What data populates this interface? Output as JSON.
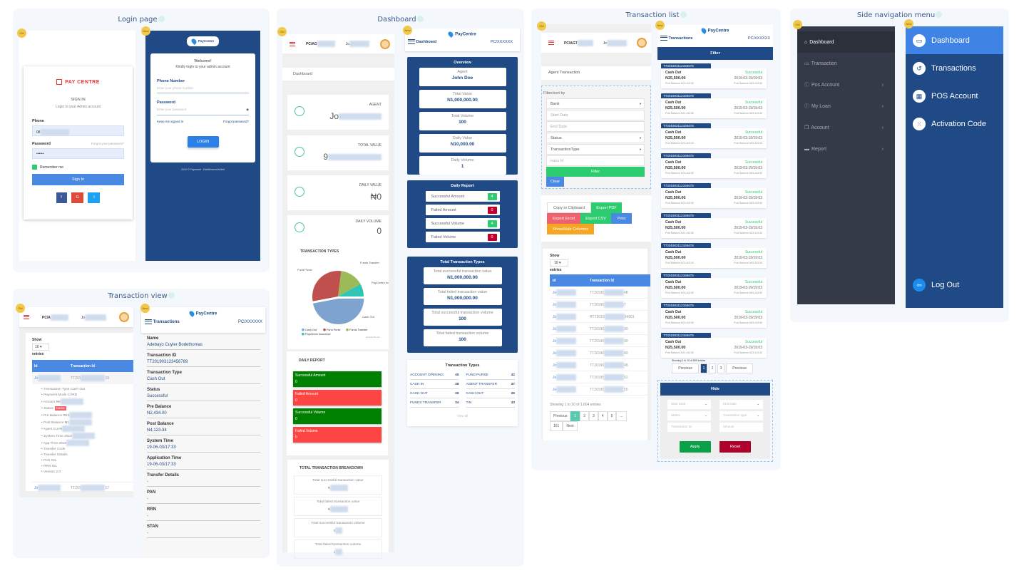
{
  "badges": {
    "old": "Old",
    "new": "New"
  },
  "brand": {
    "name": "PayCentre",
    "old_logo": "PAY CENTRE",
    "footer": "2019 © Paycentre - Esettlement limited"
  },
  "colors": {
    "navy": "#1f4a85",
    "blue": "#4a89e3",
    "green": "#008000",
    "red": "#ff4444",
    "success": "#2ecc71",
    "danger": "#c0392b"
  },
  "login": {
    "title": "Login page",
    "old": {
      "heading": "SIGN IN",
      "subheading": "Login to your Admin account",
      "phone_label": "Phone",
      "phone_value": "08",
      "password_label": "Password",
      "forgot": "Forgot your password?",
      "password_value": "••••••",
      "remember": "Remember me",
      "signin": "Sign In",
      "social": [
        "f",
        "G",
        "t"
      ]
    },
    "new": {
      "welcome": "Welcome!",
      "subtitle": "Kindly login to your admin account",
      "phone_label": "Phone Number",
      "phone_placeholder": "Enter your phone number",
      "password_label": "Password",
      "password_placeholder": "Enter your password",
      "keep": "Keep me signed in",
      "forgot": "Forgot password?",
      "login": "LOGIN"
    }
  },
  "txview": {
    "title": "Transaction view",
    "old": {
      "agent_code": "PC/A",
      "agent_name": "Jo",
      "show": "Show",
      "entries_value": "10",
      "entries": "entries",
      "col_id": "Id",
      "col_txid": "Transaction Id",
      "row1_id": "Jo",
      "row1_tx": "TT201",
      "row1_tail": "18",
      "details": [
        "Transaction Type Cash Out",
        "Payment Mode CARD",
        "Amount ₦9",
        "Status",
        "Pre Balance ₦15",
        "Post Balance ₦1",
        "Agent Cut ₦",
        "System Time 2019",
        "App Time 2019",
        "Transfer Code",
        "Transfer Details",
        "PAN NIL",
        "RRN NIL",
        "Version 2.0"
      ],
      "status_badge": "FAILED",
      "row2_id": "Jo",
      "row2_tx": "TT201",
      "row2_tail": "17"
    },
    "new": {
      "header": "Transactions",
      "agent_code": "PC/XXXXXX",
      "fields": [
        {
          "label": "Name",
          "value": "Adebayo Cuyler Bodethomas"
        },
        {
          "label": "Transaction ID",
          "value": "TT201903123456789"
        },
        {
          "label": "Transaction Type",
          "value": "Cash Out"
        },
        {
          "label": "Status",
          "value": "Successful"
        },
        {
          "label": "Pre Balance",
          "value": "N2,434.00"
        },
        {
          "label": "Post Balance",
          "value": "N4,123.34"
        },
        {
          "label": "System Time",
          "value": "19-06-03/17:33"
        },
        {
          "label": "Application Time",
          "value": "19-06-03/17:33"
        },
        {
          "label": "Transfer Details",
          "value": "-"
        },
        {
          "label": "PAN",
          "value": "-"
        },
        {
          "label": "RRN",
          "value": "-"
        },
        {
          "label": "STAN",
          "value": "-"
        }
      ]
    }
  },
  "dashboard": {
    "title": "Dashboard",
    "old": {
      "agent_code": "PC/AG",
      "agent_name": "Jo",
      "breadcrumb": "Dashboard",
      "cards": [
        {
          "label": "AGENT",
          "value": "Jo"
        },
        {
          "label": "TOTAL VALUE",
          "value": "9"
        },
        {
          "label": "DAILY VALUE",
          "value": "₦0"
        },
        {
          "label": "DAILY VOLUME",
          "value": "0"
        }
      ],
      "tx_types_title": "TRANSACTION TYPES",
      "pie": {
        "labels": [
          "Fund Purse",
          "Funds Transfer",
          "PayCentre Insurance",
          "Cash Out"
        ],
        "legend": [
          "Cash Out",
          "Fund Purse",
          "Funds Transfer",
          "PayCentre Insurance"
        ],
        "colors": [
          "#7fa3cf",
          "#c0504d",
          "#9bbb59",
          "#2ec4b6"
        ],
        "shares": [
          47,
          30,
          15,
          8
        ],
        "credit": "CanvasJS.com"
      },
      "daily_title": "DAILY REPORT",
      "daily": [
        {
          "label": "Successful Amount",
          "value": "0",
          "color": "#008000"
        },
        {
          "label": "Failed Amount",
          "value": "0",
          "color": "#ff4444"
        },
        {
          "label": "Successful Volume",
          "value": "0",
          "color": "#008000"
        },
        {
          "label": "Failed Volume",
          "value": "0",
          "color": "#ff4444"
        }
      ],
      "breakdown_title": "TOTAL TRANSACTION BREAKDOWN",
      "breakdown": [
        {
          "label": "Total successful transaction value",
          "value": "₦"
        },
        {
          "label": "Total failed transaction value",
          "value": "₦"
        },
        {
          "label": "Total successful transaction volume",
          "value": "5"
        },
        {
          "label": "Total failed transaction volume",
          "value": "1"
        }
      ]
    },
    "new": {
      "header": "Dashboard",
      "agent_code": "PC/XXXXXX",
      "overview_title": "Overview",
      "overview": [
        {
          "label": "Agent",
          "value": "John Doe"
        },
        {
          "label": "Total Value",
          "value": "N1,000,000.00"
        },
        {
          "label": "Total Volume",
          "value": "100"
        },
        {
          "label": "Daily Value",
          "value": "N10,000.00"
        },
        {
          "label": "Daily Volume",
          "value": "1"
        }
      ],
      "daily_title": "Daily Report",
      "daily": [
        {
          "label": "Successful Amount",
          "value": "4",
          "status": "success"
        },
        {
          "label": "Failed Amount",
          "value": "0",
          "status": "danger"
        },
        {
          "label": "Successful Volume",
          "value": "4",
          "status": "success"
        },
        {
          "label": "Failed Volume",
          "value": "0",
          "status": "danger"
        }
      ],
      "totals_title": "Total Transaction Types",
      "totals": [
        {
          "label": "Total successful transaction value",
          "value": "N1,000,000.00"
        },
        {
          "label": "Total failed transaction value",
          "value": "N1,000,000.00"
        },
        {
          "label": "Total successful transaction volume",
          "value": "100"
        },
        {
          "label": "Total failed transaction volume",
          "value": "100"
        }
      ],
      "types_title": "Transaction Types",
      "types": [
        {
          "name": "ACCOUNT OPENING",
          "count": "45"
        },
        {
          "name": "FUND PURSE",
          "count": "42"
        },
        {
          "name": "CASH IN",
          "count": "38"
        },
        {
          "name": "AGENT TRANSFER",
          "count": "37"
        },
        {
          "name": "CASH OUT",
          "count": "36"
        },
        {
          "name": "CASH OUT",
          "count": "35"
        },
        {
          "name": "FUNDS TRANSFER",
          "count": "34"
        },
        {
          "name": "TIN",
          "count": "33"
        }
      ],
      "view_all": "View all"
    }
  },
  "txlist": {
    "title": "Transaction list",
    "old": {
      "agent_code": "PC/AGT",
      "agent_name": "Jo",
      "breadcrumb": "Agent Transaction",
      "filter_title": "Filter/sort by",
      "filters": [
        {
          "label": "Bank",
          "select": true
        },
        {
          "label": "Start Date",
          "select": false
        },
        {
          "label": "End Date",
          "select": false
        },
        {
          "label": "Status",
          "select": true
        },
        {
          "label": "TransactionType",
          "select": true
        },
        {
          "label": "trans Id",
          "select": false
        }
      ],
      "filter_btn": "Filter",
      "clear_btn": "Clear",
      "exports": [
        {
          "label": "Copy to Clipboard",
          "color": "#ffffff"
        },
        {
          "label": "Export PDF",
          "color": "#2ecc71"
        },
        {
          "label": "Export Excel",
          "color": "#f0616e"
        },
        {
          "label": "Export CSV",
          "color": "#2ecc71"
        },
        {
          "label": "Print",
          "color": "#4a89e3"
        },
        {
          "label": "Show/Hide Columns",
          "color": "#f5a623"
        }
      ],
      "show": "Show",
      "entries_value": "10",
      "entries": "entries",
      "col_id": "Id",
      "col_txid": "Transaction Id",
      "rows": [
        {
          "id": "Jo",
          "tx": "TT20190",
          "tail": "48"
        },
        {
          "id": "Jo",
          "tx": "TT20190",
          "tail": "7"
        },
        {
          "id": "Jo",
          "tx": "RTT2019",
          "tail": "84901"
        },
        {
          "id": "Jo",
          "tx": "TT20190",
          "tail": "90"
        },
        {
          "id": "Jo",
          "tx": "TT20190",
          "tail": "90"
        },
        {
          "id": "Jo",
          "tx": "TT20190",
          "tail": "49"
        },
        {
          "id": "Jo",
          "tx": "TT20190",
          "tail": "48"
        },
        {
          "id": "Jo",
          "tx": "TT20190",
          "tail": "52"
        },
        {
          "id": "Jo",
          "tx": "TT20190",
          "tail": "55"
        }
      ],
      "info": "Showing 1 to 10 of 1,604 entries",
      "pages": [
        "Previous",
        "1",
        "2",
        "3",
        "4",
        "5",
        "...",
        "161",
        "Next"
      ]
    },
    "new": {
      "header": "Transactions",
      "agent_code": "PC/XXXXXX",
      "filter": "Filter",
      "card": {
        "id": "TT201903112345678",
        "type": "Cash Out",
        "status": "Successful",
        "amount": "N25,500.00",
        "time": "2019-03-19/19:03",
        "pre": "Post Balance-N23,443.80",
        "post": "Post Balance-N53,443.80"
      },
      "count": 10,
      "info": "Showing 1 to 10 of 500 entries",
      "pages": [
        "Previous",
        "1",
        "2",
        "3",
        "Previous"
      ],
      "hide": "Hide",
      "fields": [
        {
          "label": "Start Date",
          "select": true
        },
        {
          "label": "End Date",
          "select": true
        },
        {
          "label": "Status",
          "select": true
        },
        {
          "label": "Transaction type",
          "select": true
        },
        {
          "label": "Transaction ID",
          "select": false
        },
        {
          "label": "Amount",
          "select": false
        }
      ],
      "apply": "Apply",
      "reset": "Reset"
    }
  },
  "sidenav": {
    "title": "Side navigation menu",
    "old": [
      {
        "label": "Dashboard",
        "icon": "home-icon",
        "chev": false,
        "active": true
      },
      {
        "label": "Transaction",
        "icon": "card-icon",
        "chev": false
      },
      {
        "label": "Pos Account",
        "icon": "info-icon",
        "chev": true
      },
      {
        "label": "My Loan",
        "icon": "info-icon",
        "chev": true
      },
      {
        "label": "Account",
        "icon": "copy-icon",
        "chev": true
      },
      {
        "label": "Report",
        "icon": "printer-icon",
        "chev": true
      }
    ],
    "new": [
      {
        "label": "Dashboard",
        "icon": "monitor-icon",
        "active": true
      },
      {
        "label": "Transactions",
        "icon": "history-icon"
      },
      {
        "label": "POS Account",
        "icon": "calculator-icon"
      },
      {
        "label": "Activation Code",
        "icon": "grid-icon"
      }
    ],
    "logout": "Log Out"
  }
}
